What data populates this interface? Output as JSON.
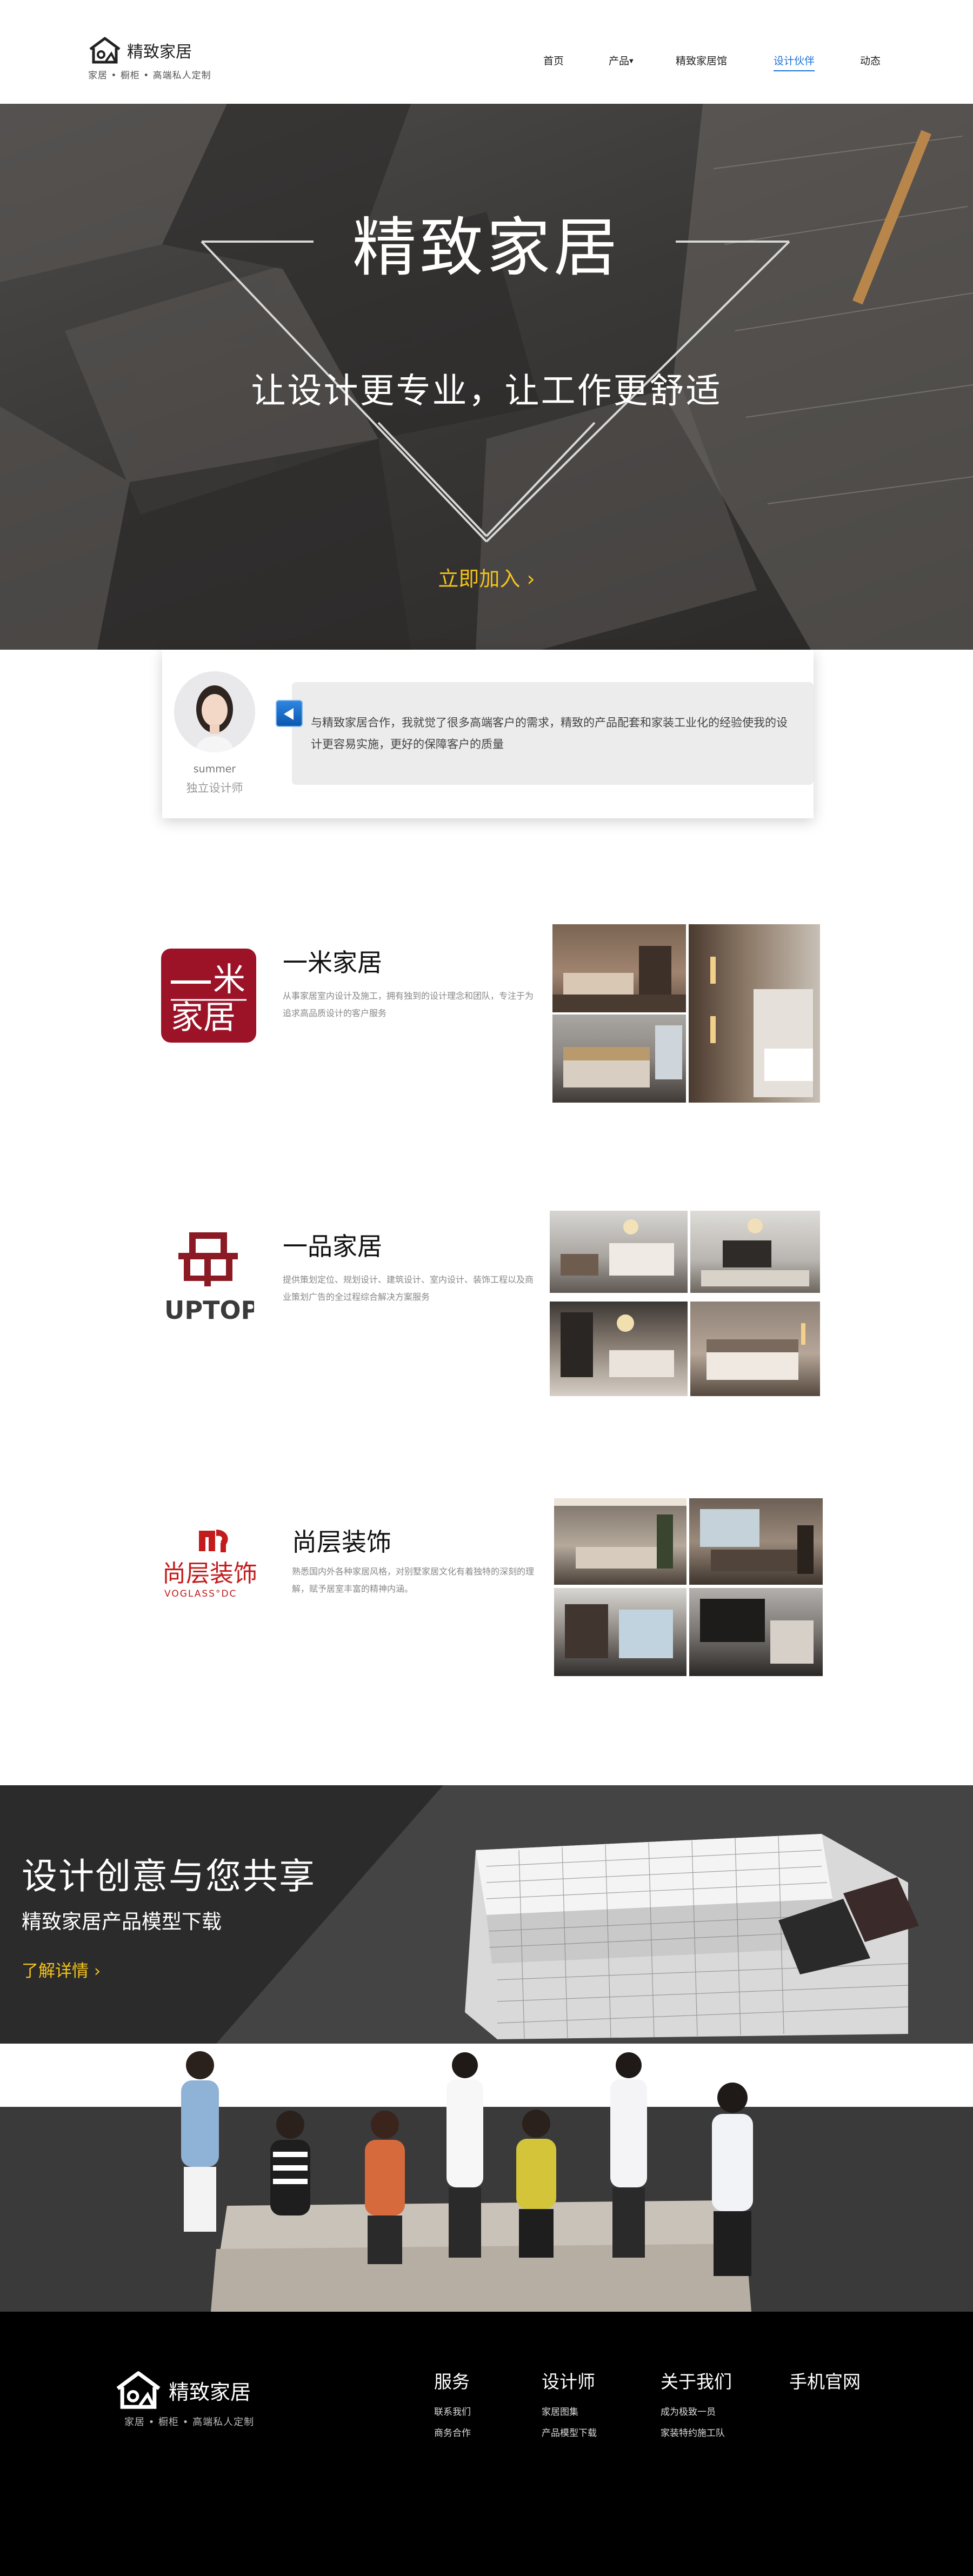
{
  "header": {
    "logo_name": "精致家居",
    "logo_tagline": "家居 • 橱柜 • 高端私人定制",
    "nav": [
      {
        "label": "首页"
      },
      {
        "label": "产品"
      },
      {
        "label": "精致家居馆"
      },
      {
        "label": "设计伙伴",
        "active": true
      },
      {
        "label": "动态"
      }
    ]
  },
  "hero": {
    "title": "精致家居",
    "subtitle": "让设计更专业，让工作更舒适",
    "cta": "立即加入 ›"
  },
  "testimonial": {
    "name": "summer",
    "role": "独立设计师",
    "quote": "与精致家居合作，我就觉了很多高端客户的需求，精致的产品配套和家装工业化的经验使我的设计更容易实施，更好的保障客户的质量"
  },
  "brands": [
    {
      "title": "一米家居",
      "logo_text": "一米家居",
      "description": "从事家居室内设计及施工，拥有独到的设计理念和团队，专注于为追求高品质设计的客户服务"
    },
    {
      "title": "一品家居",
      "logo_text": "UPTOP",
      "description": "提供策划定位、规划设计、建筑设计、室内设计、装饰工程以及商业策划广告的全过程综合解决方案服务"
    },
    {
      "title": "尚层装饰",
      "logo_text": "尚层装饰",
      "logo_sub": "VOGLASS°DC",
      "description": "熟悉国内外各种家居风格，对别墅家居文化有着独特的深刻的理解，赋予居室丰富的精神内涵。"
    }
  ],
  "banner": {
    "title": "设计创意与您共享",
    "subtitle": "精致家居产品模型下载",
    "link": "了解详情 ›"
  },
  "footer": {
    "logo_name": "精致家居",
    "logo_tagline": "家居 • 橱柜 • 高端私人定制",
    "columns": [
      {
        "title": "服务",
        "links": [
          "联系我们",
          "商务合作"
        ]
      },
      {
        "title": "设计师",
        "links": [
          "家居图集",
          "产品模型下载"
        ]
      },
      {
        "title": "关于我们",
        "links": [
          "成为极致一员",
          "家装特约施工队"
        ]
      },
      {
        "title": "手机官网",
        "links": []
      }
    ]
  },
  "colors": {
    "accent_blue": "#1a73d9",
    "accent_yellow": "#f2c21b",
    "dark_band": "#3a3a3b",
    "footer_bg": "#000000"
  }
}
